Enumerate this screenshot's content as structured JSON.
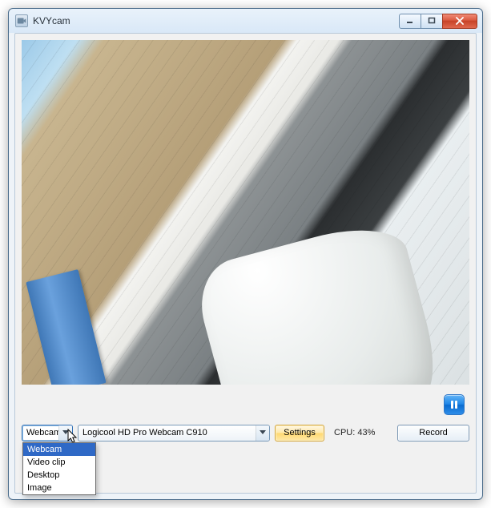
{
  "window": {
    "title": "KVYcam"
  },
  "controls": {
    "source_selected": "Webcam",
    "source_options": [
      "Webcam",
      "Video clip",
      "Desktop",
      "Image"
    ],
    "device_selected": "Logicool HD Pro Webcam C910",
    "settings_label": "Settings",
    "record_label": "Record",
    "cpu_label": "CPU: 43%"
  },
  "icons": {
    "pause": "pause"
  }
}
